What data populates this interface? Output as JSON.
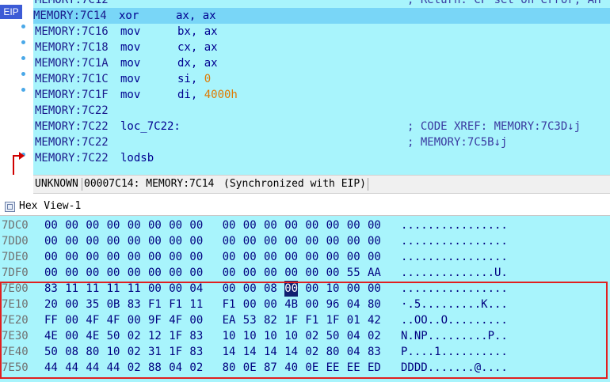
{
  "disasm": {
    "eip_badge": "EIP",
    "top_partial": {
      "addr": "MEMORY:7C12",
      "comment": "; Return: CF set on error, AH"
    },
    "lines": [
      {
        "addr": "MEMORY:7C14",
        "mnemonic": "xor",
        "op1": "ax, ",
        "op2": "ax",
        "op2_num": false,
        "comment": "",
        "current": true
      },
      {
        "addr": "MEMORY:7C16",
        "mnemonic": "mov",
        "op1": "bx, ",
        "op2": "ax",
        "op2_num": false,
        "comment": "",
        "current": false
      },
      {
        "addr": "MEMORY:7C18",
        "mnemonic": "mov",
        "op1": "cx, ",
        "op2": "ax",
        "op2_num": false,
        "comment": "",
        "current": false
      },
      {
        "addr": "MEMORY:7C1A",
        "mnemonic": "mov",
        "op1": "dx, ",
        "op2": "ax",
        "op2_num": false,
        "comment": "",
        "current": false
      },
      {
        "addr": "MEMORY:7C1C",
        "mnemonic": "mov",
        "op1": "si, ",
        "op2": "0",
        "op2_num": true,
        "comment": "",
        "current": false
      },
      {
        "addr": "MEMORY:7C1F",
        "mnemonic": "mov",
        "op1": "di, ",
        "op2": "4000h",
        "op2_num": true,
        "comment": "",
        "current": false
      },
      {
        "addr": "MEMORY:7C22",
        "mnemonic": "",
        "op1": "",
        "op2": "",
        "op2_num": false,
        "comment": "",
        "current": false
      },
      {
        "addr": "MEMORY:7C22",
        "mnemonic": "loc_7C22:",
        "op1": "",
        "op2": "",
        "op2_num": false,
        "comment": "; CODE XREF: MEMORY:7C3D↓j",
        "current": false
      },
      {
        "addr": "MEMORY:7C22",
        "mnemonic": "",
        "op1": "",
        "op2": "",
        "op2_num": false,
        "comment": "; MEMORY:7C5B↓j",
        "current": false
      },
      {
        "addr": "MEMORY:7C22",
        "mnemonic": "lodsb",
        "op1": "",
        "op2": "",
        "op2_num": false,
        "comment": "",
        "current": false
      }
    ]
  },
  "status": {
    "segment": "UNKNOWN",
    "location": "00007C14: MEMORY:7C14",
    "sync": "(Synchronized with EIP)"
  },
  "hex_view": {
    "title": "Hex View-1",
    "rows": [
      {
        "addr": "7DC0",
        "bytes": [
          "00",
          "00",
          "00",
          "00",
          "00",
          "00",
          "00",
          "00",
          "00",
          "00",
          "00",
          "00",
          "00",
          "00",
          "00",
          "00"
        ],
        "ascii": "................"
      },
      {
        "addr": "7DD0",
        "bytes": [
          "00",
          "00",
          "00",
          "00",
          "00",
          "00",
          "00",
          "00",
          "00",
          "00",
          "00",
          "00",
          "00",
          "00",
          "00",
          "00"
        ],
        "ascii": "................"
      },
      {
        "addr": "7DE0",
        "bytes": [
          "00",
          "00",
          "00",
          "00",
          "00",
          "00",
          "00",
          "00",
          "00",
          "00",
          "00",
          "00",
          "00",
          "00",
          "00",
          "00"
        ],
        "ascii": "................"
      },
      {
        "addr": "7DF0",
        "bytes": [
          "00",
          "00",
          "00",
          "00",
          "00",
          "00",
          "00",
          "00",
          "00",
          "00",
          "00",
          "00",
          "00",
          "00",
          "55",
          "AA"
        ],
        "ascii": "..............U."
      },
      {
        "addr": "7E00",
        "bytes": [
          "83",
          "11",
          "11",
          "11",
          "11",
          "00",
          "00",
          "04",
          "00",
          "00",
          "08",
          "00",
          "00",
          "10",
          "00",
          "00"
        ],
        "ascii": "................"
      },
      {
        "addr": "7E10",
        "bytes": [
          "20",
          "00",
          "35",
          "0B",
          "83",
          "F1",
          "F1",
          "11",
          "F1",
          "00",
          "00",
          "4B",
          "00",
          "96",
          "04",
          "80"
        ],
        "ascii": "·.5.........K..."
      },
      {
        "addr": "7E20",
        "bytes": [
          "FF",
          "00",
          "4F",
          "4F",
          "00",
          "9F",
          "4F",
          "00",
          "EA",
          "53",
          "82",
          "1F",
          "F1",
          "1F",
          "01",
          "42"
        ],
        "ascii": "..OO..O........."
      },
      {
        "addr": "7E30",
        "bytes": [
          "4E",
          "00",
          "4E",
          "50",
          "02",
          "12",
          "1F",
          "83",
          "10",
          "10",
          "10",
          "10",
          "02",
          "50",
          "04",
          "02"
        ],
        "ascii": "N.NP.........P.."
      },
      {
        "addr": "7E40",
        "bytes": [
          "50",
          "08",
          "80",
          "10",
          "02",
          "31",
          "1F",
          "83",
          "14",
          "14",
          "14",
          "14",
          "02",
          "80",
          "04",
          "83"
        ],
        "ascii": "P....1.........."
      },
      {
        "addr": "7E50",
        "bytes": [
          "44",
          "44",
          "44",
          "44",
          "02",
          "88",
          "04",
          "02",
          "80",
          "0E",
          "87",
          "40",
          "0E",
          "EE",
          "EE",
          "ED"
        ],
        "ascii": "DDDD.......@...."
      }
    ],
    "selected": {
      "row": 4,
      "col": 11
    }
  }
}
